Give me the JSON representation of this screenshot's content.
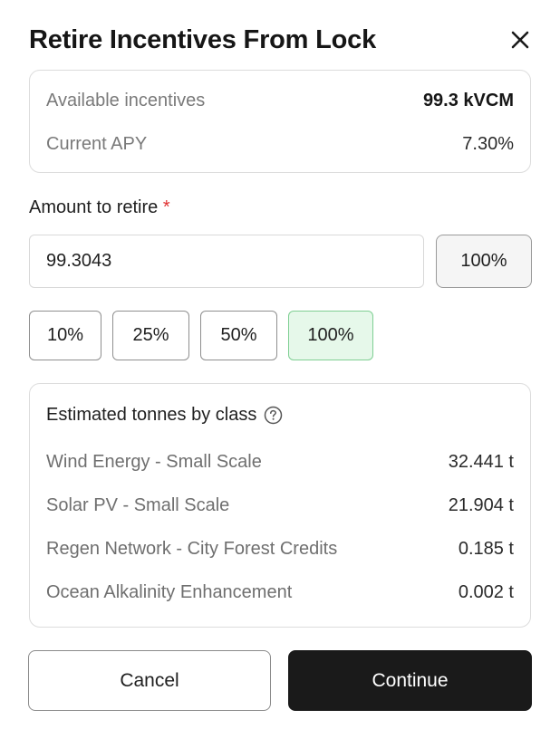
{
  "dialog": {
    "title": "Retire Incentives From Lock"
  },
  "summary": {
    "available_label": "Available incentives",
    "available_value": "99.3 kVCM",
    "apy_label": "Current APY",
    "apy_value": "7.30%"
  },
  "amount": {
    "label": "Amount to retire",
    "required_marker": "*",
    "value": "99.3043",
    "max_label": "100%"
  },
  "presets": [
    "10%",
    "25%",
    "50%",
    "100%"
  ],
  "presets_selected": "100%",
  "estimates": {
    "heading": "Estimated tonnes by class",
    "rows": [
      {
        "name": "Wind Energy - Small Scale",
        "value": "32.441 t"
      },
      {
        "name": "Solar PV - Small Scale",
        "value": "21.904 t"
      },
      {
        "name": "Regen Network - City Forest Credits",
        "value": "0.185 t"
      },
      {
        "name": "Ocean Alkalinity Enhancement",
        "value": "0.002 t"
      }
    ]
  },
  "actions": {
    "cancel_label": "Cancel",
    "continue_label": "Continue"
  },
  "colors": {
    "selected_chip_bg": "#e6f8ea",
    "primary_button": "#1a1a1a",
    "required": "#e03131"
  }
}
